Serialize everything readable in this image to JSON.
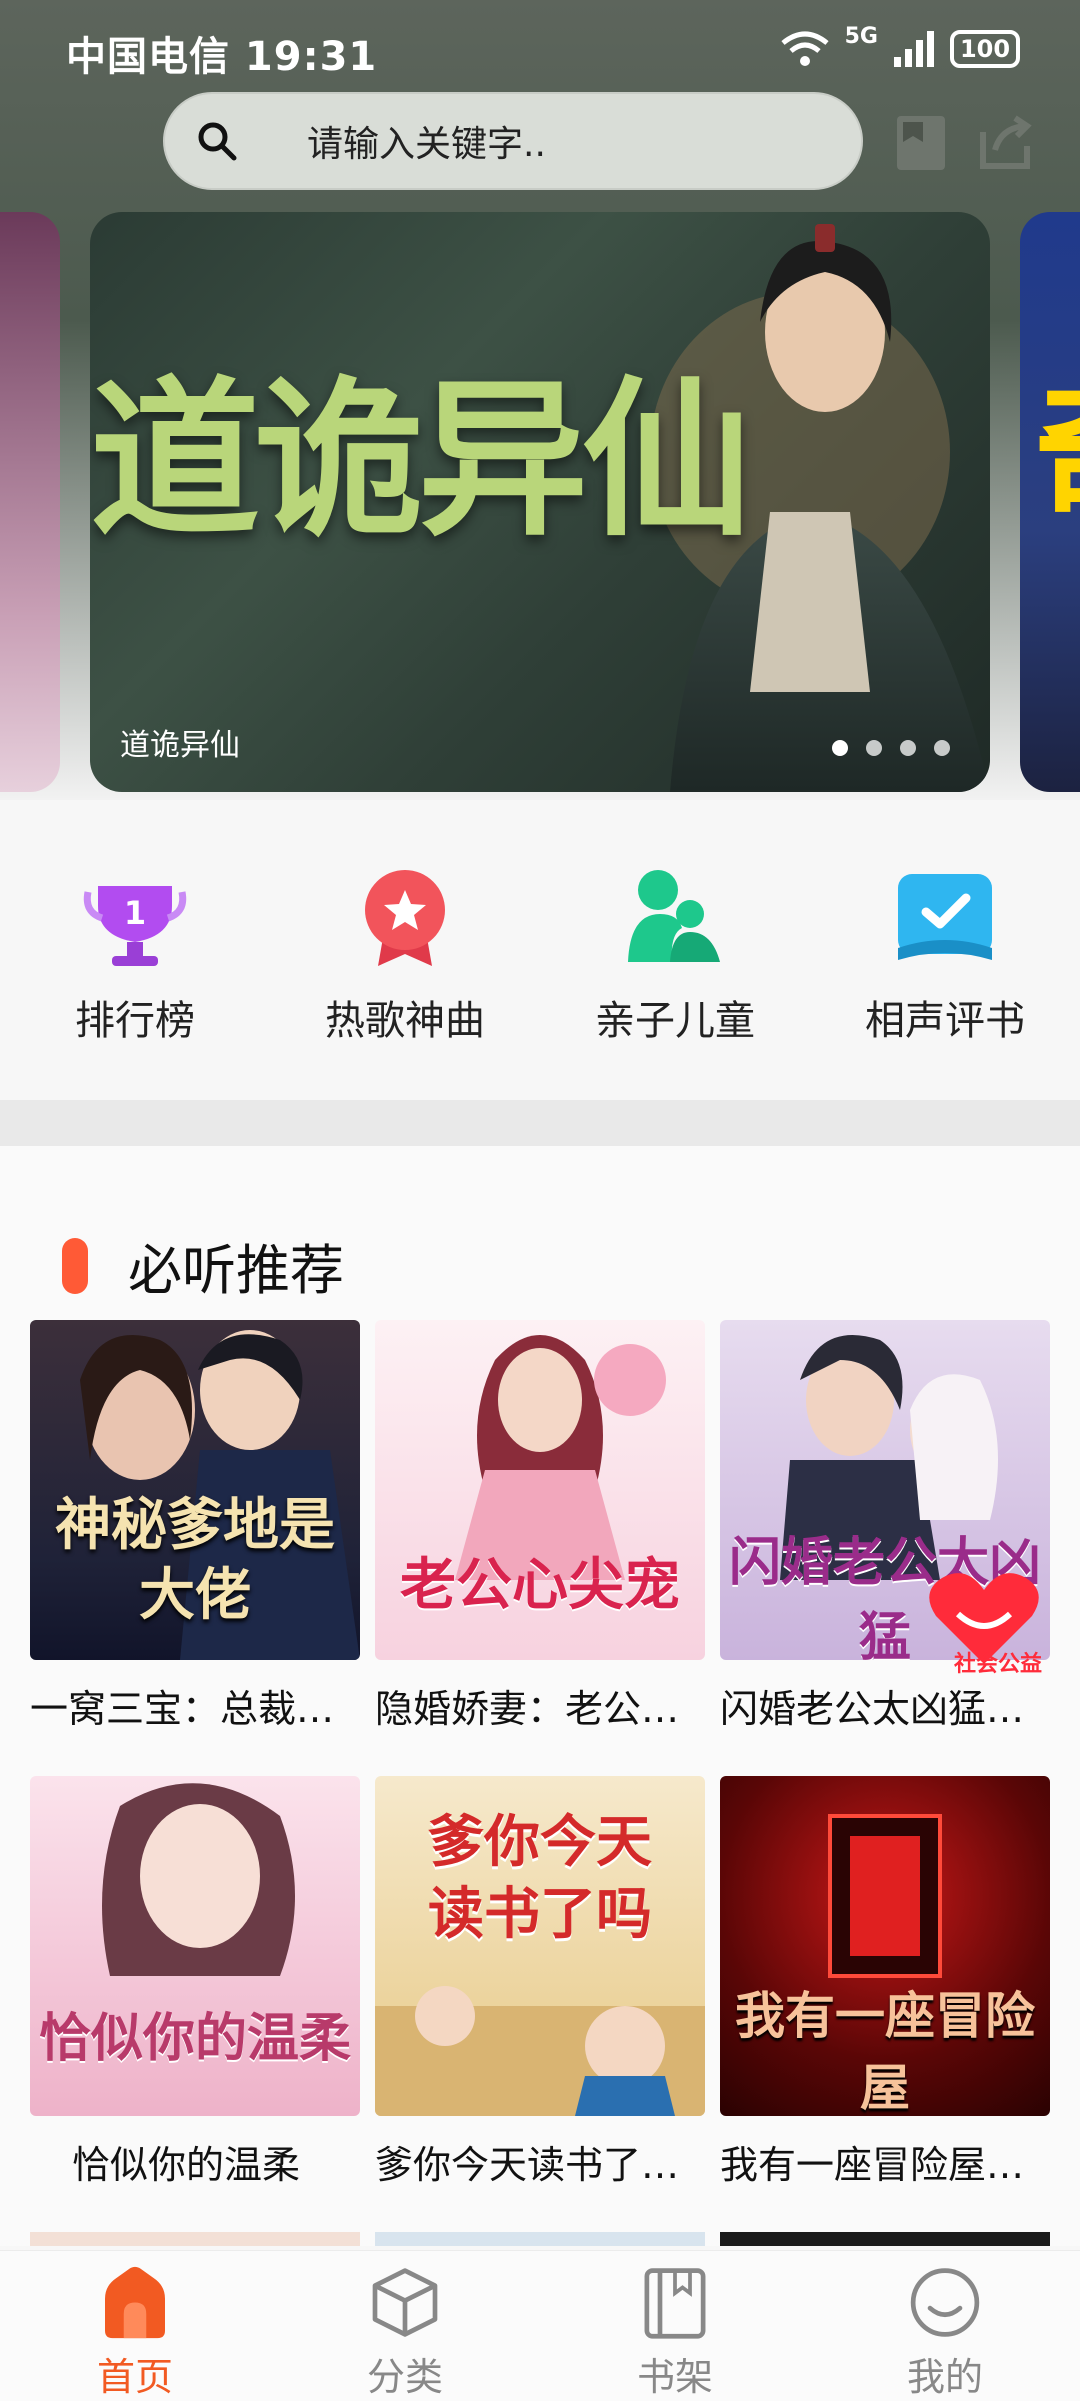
{
  "status_bar": {
    "carrier_time": "中国电信 19:31",
    "network": "5G",
    "battery": "100"
  },
  "search": {
    "placeholder": "请输入关键字.."
  },
  "banner": {
    "caption": "道诡异仙",
    "art_title": "道诡异仙",
    "slide_count": 4,
    "active_slide": 1,
    "right_peek_glyph": "奇"
  },
  "quick_nav": [
    {
      "label": "排行榜",
      "icon": "trophy-icon",
      "color": "#b24cf0"
    },
    {
      "label": "热歌神曲",
      "icon": "star-medal-icon",
      "color": "#f2545b"
    },
    {
      "label": "亲子儿童",
      "icon": "parent-child-icon",
      "color": "#1ec88c"
    },
    {
      "label": "相声评书",
      "icon": "book-check-icon",
      "color": "#2fb6f0"
    }
  ],
  "section": {
    "title": "必听推荐",
    "books": [
      {
        "title": "一窝三宝：总裁…",
        "cover_text": "神秘爹地是大佬",
        "cover_colors": [
          "#2a2c44",
          "#5c4a60"
        ]
      },
      {
        "title": "隐婚娇妻：老公…",
        "cover_text": "老公心尖宠",
        "cover_colors": [
          "#fbe9ef",
          "#f6c6d6"
        ]
      },
      {
        "title": "闪婚老公太凶猛…",
        "cover_text": "闪婚老公太凶猛",
        "cover_colors": [
          "#d9c8e8",
          "#b79ad0"
        ],
        "badge": "社会公益"
      },
      {
        "title": "恰似你的温柔",
        "cover_text": "恰似你的温柔",
        "cover_colors": [
          "#f8d6e2",
          "#e9a9c4"
        ]
      },
      {
        "title": "爹你今天读书了…",
        "cover_text": "爹你今天读书了吗",
        "cover_colors": [
          "#f6e7c8",
          "#e9c98a"
        ]
      },
      {
        "title": "我有一座冒险屋…",
        "cover_text": "我有一座冒险屋",
        "cover_colors": [
          "#3a0606",
          "#a01010"
        ]
      }
    ]
  },
  "tabs": [
    {
      "label": "首页",
      "icon": "home-icon",
      "active": true
    },
    {
      "label": "分类",
      "icon": "cube-icon",
      "active": false
    },
    {
      "label": "书架",
      "icon": "bookshelf-icon",
      "active": false
    },
    {
      "label": "我的",
      "icon": "smile-profile-icon",
      "active": false
    }
  ],
  "colors": {
    "accent": "#f25a22",
    "section_mark": "#ff5a36"
  }
}
